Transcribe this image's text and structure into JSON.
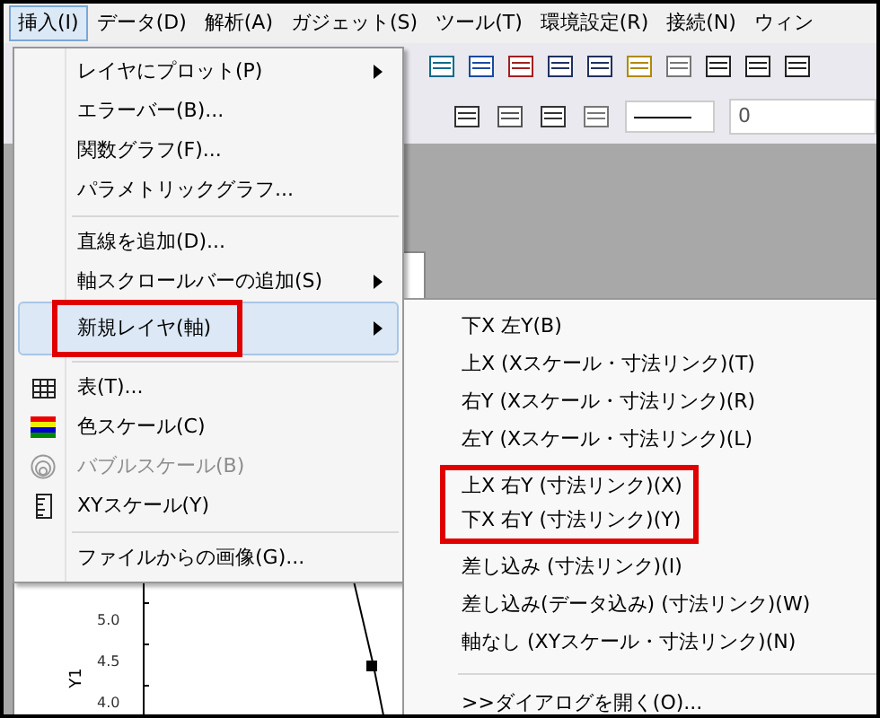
{
  "menubar": [
    {
      "label": "挿入(I)",
      "selected": true
    },
    {
      "label": "データ(D)",
      "selected": false
    },
    {
      "label": "解析(A)",
      "selected": false
    },
    {
      "label": "ガジェット(S)",
      "selected": false
    },
    {
      "label": "ツール(T)",
      "selected": false
    },
    {
      "label": "環境設定(R)",
      "selected": false
    },
    {
      "label": "接続(N)",
      "selected": false
    },
    {
      "label": "ウィン",
      "selected": false
    }
  ],
  "toolbar": {
    "line_field": "0"
  },
  "graph": {
    "ylabel": "Y1",
    "yticks": [
      "5.0",
      "4.5",
      "4.0"
    ]
  },
  "menu": [
    {
      "kind": "plain",
      "label": "レイヤにプロット(P)",
      "submenu": true,
      "selected": false,
      "disabled": false,
      "annotated": false
    },
    {
      "kind": "plain",
      "label": "エラーバー(B)...",
      "submenu": false,
      "selected": false,
      "disabled": false,
      "annotated": false
    },
    {
      "kind": "plain",
      "label": "関数グラフ(F)...",
      "submenu": false,
      "selected": false,
      "disabled": false,
      "annotated": false
    },
    {
      "kind": "plain",
      "label": "パラメトリックグラフ...",
      "submenu": false,
      "selected": false,
      "disabled": false,
      "annotated": false
    },
    {
      "kind": "separator"
    },
    {
      "kind": "plain",
      "label": "直線を追加(D)...",
      "submenu": false,
      "selected": false,
      "disabled": false,
      "annotated": false
    },
    {
      "kind": "plain",
      "label": "軸スクロールバーの追加(S)",
      "submenu": true,
      "selected": false,
      "disabled": false,
      "annotated": false
    },
    {
      "kind": "plain",
      "label": "新規レイヤ(軸)",
      "submenu": true,
      "selected": true,
      "disabled": false,
      "annotated": true
    },
    {
      "kind": "separator"
    },
    {
      "kind": "grid",
      "label": "表(T)...",
      "submenu": false,
      "selected": false,
      "disabled": false,
      "annotated": false
    },
    {
      "kind": "stripes",
      "label": "色スケール(C)",
      "submenu": false,
      "selected": false,
      "disabled": false,
      "annotated": false
    },
    {
      "kind": "rings",
      "label": "バブルスケール(B)",
      "submenu": false,
      "selected": false,
      "disabled": true,
      "annotated": false
    },
    {
      "kind": "ruler",
      "label": "XYスケール(Y)",
      "submenu": false,
      "selected": false,
      "disabled": false,
      "annotated": false
    },
    {
      "kind": "separator"
    },
    {
      "kind": "plain",
      "label": "ファイルからの画像(G)...",
      "submenu": false,
      "selected": false,
      "disabled": false,
      "annotated": false
    }
  ],
  "submenu": [
    {
      "annotated": false,
      "items": [
        "下X 左Y(B)",
        "上X (Xスケール・寸法リンク)(T)",
        "右Y (Xスケール・寸法リンク)(R)",
        "左Y (Xスケール・寸法リンク)(L)"
      ]
    },
    {
      "annotated": true,
      "items": [
        "上X 右Y (寸法リンク)(X)",
        "下X 右Y (寸法リンク)(Y)"
      ]
    },
    {
      "annotated": false,
      "items": [
        "差し込み (寸法リンク)(I)",
        "差し込み(データ込み) (寸法リンク)(W)",
        "軸なし (XYスケール・寸法リンク)(N)"
      ]
    },
    {
      "annotated": false,
      "separator": true,
      "items": [
        ">>ダイアログを開く(O)..."
      ]
    }
  ]
}
